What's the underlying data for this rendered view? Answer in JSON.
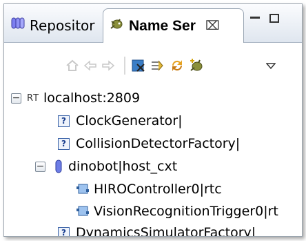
{
  "tabs": {
    "repository": {
      "label": "Repositor",
      "icon": "repository-icon"
    },
    "name_service": {
      "label": "Name Ser",
      "icon": "name-service-icon",
      "close_glyph": "⌧"
    }
  },
  "window_controls": {
    "minimize": "minimize-icon",
    "maximize": "maximize-icon"
  },
  "toolbar": {
    "icons": [
      "home-icon",
      "back-icon",
      "forward-icon",
      "collapse-icon",
      "filter-icon",
      "refresh-icon",
      "add-name-server-icon",
      "view-menu-icon"
    ]
  },
  "tree": {
    "root": {
      "prefix": "RT",
      "label": "localhost:2809",
      "expander": "−"
    },
    "items": [
      {
        "label": "ClockGenerator|",
        "icon": "unknown-object-icon"
      },
      {
        "label": "CollisionDetectorFactory|",
        "icon": "unknown-object-icon"
      },
      {
        "label": "dinobot|host_cxt",
        "icon": "host-context-icon",
        "expander": "−"
      },
      {
        "label": "HIROController0|rtc",
        "icon": "rt-component-icon"
      },
      {
        "label": "VisionRecognitionTrigger0|rt",
        "icon": "rt-component-icon"
      },
      {
        "label": "DynamicsSimulatorFactory|",
        "icon": "unknown-object-icon"
      }
    ]
  },
  "colors": {
    "accent": "#3b63a8",
    "tab_bar": "#dfe6ef",
    "border": "#9aa4ae"
  }
}
